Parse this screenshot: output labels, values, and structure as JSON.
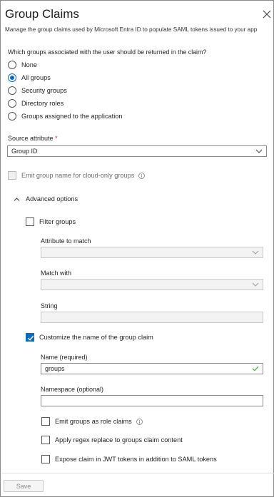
{
  "header": {
    "title": "Group Claims",
    "subtitle": "Manage the group claims used by Microsoft Entra ID to populate SAML tokens issued to your app"
  },
  "groups_question": "Which groups associated with the user should be returned in the claim?",
  "group_options": [
    {
      "label": "None",
      "selected": false
    },
    {
      "label": "All groups",
      "selected": true
    },
    {
      "label": "Security groups",
      "selected": false
    },
    {
      "label": "Directory roles",
      "selected": false
    },
    {
      "label": "Groups assigned to the application",
      "selected": false
    }
  ],
  "source_attribute": {
    "label": "Source attribute",
    "required_mark": "*",
    "value": "Group ID"
  },
  "emit_group_name": {
    "label": "Emit group name for cloud-only groups",
    "checked": false
  },
  "advanced": {
    "label": "Advanced options",
    "filter_groups": {
      "label": "Filter groups",
      "checked": false
    },
    "attribute_to_match": {
      "label": "Attribute to match",
      "value": ""
    },
    "match_with": {
      "label": "Match with",
      "value": ""
    },
    "string": {
      "label": "String",
      "value": ""
    },
    "customize_name": {
      "label": "Customize the name of the group claim",
      "checked": true
    },
    "name": {
      "label": "Name (required)",
      "value": "groups"
    },
    "namespace": {
      "label": "Namespace (optional)",
      "value": ""
    },
    "emit_role_claims": {
      "label": "Emit groups as role claims",
      "checked": false
    },
    "regex_replace": {
      "label": "Apply regex replace to groups claim content",
      "checked": false
    },
    "jwt_tokens": {
      "label": "Expose claim in JWT tokens in addition to SAML tokens",
      "checked": false
    }
  },
  "footer": {
    "save_label": "Save"
  },
  "colors": {
    "accent": "#0f6cbd",
    "required": "#c4314b",
    "valid": "#4caf50"
  },
  "icons": [
    "close-icon",
    "info-icon",
    "chevron-down-icon",
    "chevron-up-icon",
    "checkmark-icon"
  ]
}
